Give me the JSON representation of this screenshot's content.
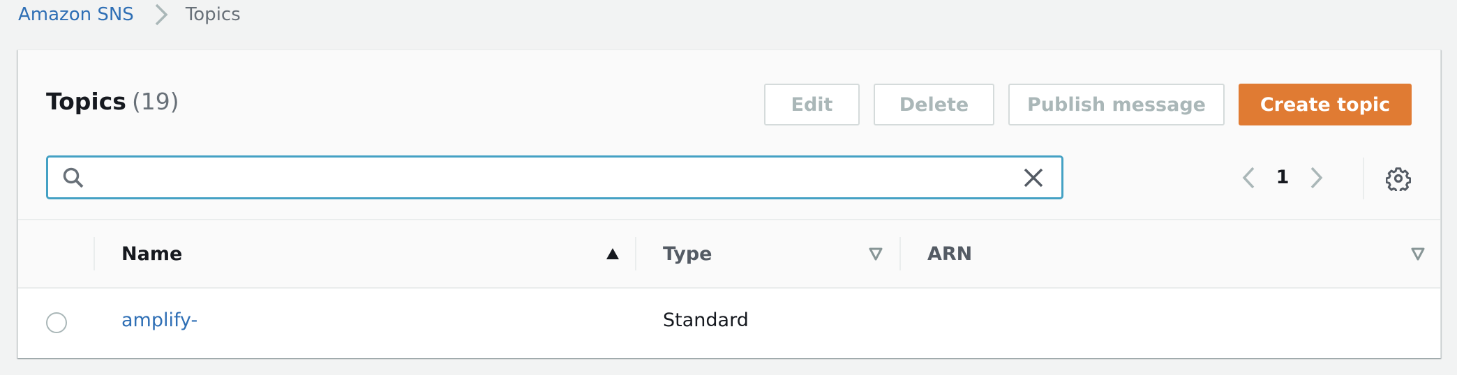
{
  "breadcrumb": {
    "items": [
      {
        "label": "Amazon SNS",
        "link": true
      },
      {
        "label": "Topics",
        "link": false
      }
    ]
  },
  "header": {
    "title": "Topics",
    "count": "(19)"
  },
  "actions": {
    "edit_label": "Edit",
    "delete_label": "Delete",
    "publish_label": "Publish message",
    "create_label": "Create topic"
  },
  "search": {
    "value": "",
    "placeholder": ""
  },
  "pagination": {
    "current_page": "1"
  },
  "table": {
    "columns": [
      {
        "label": "Name",
        "sort": "ascending"
      },
      {
        "label": "Type",
        "sort": "none"
      },
      {
        "label": "ARN",
        "sort": "none"
      }
    ],
    "rows": [
      {
        "selected": false,
        "name": "amplify-",
        "type": "Standard",
        "arn": ""
      }
    ]
  },
  "colors": {
    "primary_button": "#e07b33",
    "link": "#2f6fb5",
    "search_focus_border": "#44a1c4",
    "page_background": "#f2f3f3"
  },
  "icons": {
    "breadcrumb_separator": "chevron-right-icon",
    "search": "search-icon",
    "clear": "close-icon",
    "prev": "chevron-left-icon",
    "next": "chevron-right-icon",
    "settings": "gear-icon",
    "sort_asc": "caret-up-icon",
    "sort_none": "caret-down-outline-icon"
  }
}
